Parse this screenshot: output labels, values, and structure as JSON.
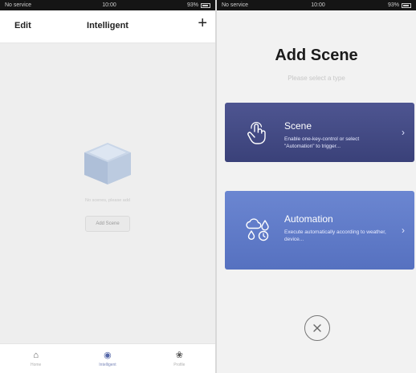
{
  "left_screen": {
    "statusbar": {
      "carrier": "No service",
      "time": "10:00",
      "battery": "93%"
    },
    "navbar": {
      "edit_label": "Edit",
      "title": "Intelligent",
      "add_icon": "plus-icon"
    },
    "empty_state": {
      "illustration_icon": "box-illustration-icon",
      "message": "No scenes, please add",
      "button_label": "Add Scene"
    },
    "tabs": [
      {
        "label": "Home",
        "icon": "home-icon"
      },
      {
        "label": "Intelligent",
        "icon": "smart-icon"
      },
      {
        "label": "Profile",
        "icon": "profile-icon"
      }
    ]
  },
  "right_screen": {
    "statusbar": {
      "carrier": "No service",
      "time": "10:00",
      "battery": "93%"
    },
    "title": "Add Scene",
    "subtitle": "Please select a type",
    "cards": [
      {
        "title": "Scene",
        "desc": "Enable one-key-control or select \"Automation\" to trigger...",
        "icon": "tap-hand-icon",
        "color": "#444a86"
      },
      {
        "title": "Automation",
        "desc": "Execute automatically according to weather, device...",
        "icon": "weather-clock-icon",
        "color": "#5f7bc8"
      }
    ],
    "close_icon": "close-icon"
  }
}
